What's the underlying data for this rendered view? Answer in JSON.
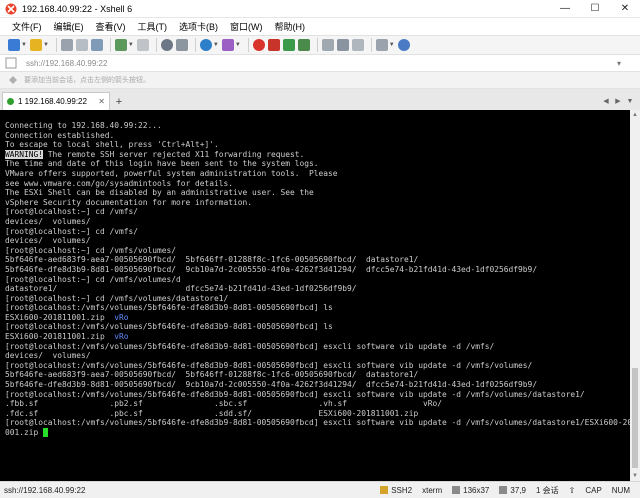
{
  "window": {
    "title": "192.168.40.99:22 - Xshell 6",
    "minimize": "—",
    "maximize": "☐",
    "close": "✕"
  },
  "menu": [
    "文件(F)",
    "编辑(E)",
    "查看(V)",
    "工具(T)",
    "选项卡(B)",
    "窗口(W)",
    "帮助(H)"
  ],
  "address": {
    "value": "ssh://192.168.40.99:22"
  },
  "hint": {
    "text": "要添加当前会话，点击左侧的箭头按钮。"
  },
  "tabs": [
    {
      "label": "1 192.168.40.99:22",
      "close": "✕"
    }
  ],
  "tab_add": "+",
  "terminal": {
    "intro": [
      "Connecting to 192.168.40.99:22...",
      "Connection established.",
      "To escape to local shell, press 'Ctrl+Alt+]'.",
      ""
    ],
    "warning_tag": "WARNING!",
    "warning_rest": " The remote SSH server rejected X11 forwarding request.",
    "body": [
      "The time and date of this login have been sent to the system logs.",
      "",
      "VMware offers supported, powerful system administration tools.  Please",
      "see www.vmware.com/go/sysadmintools for details.",
      "",
      "The ESXi Shell can be disabled by an administrative user. See the",
      "vSphere Security documentation for more information.",
      "[root@localhost:~] cd /vmfs/",
      "devices/  volumes/",
      "[root@localhost:~] cd /vmfs/",
      "devices/  volumes/",
      "[root@localhost:~] cd /vmfs/volumes/",
      "5bf646fe-aed683f9-aea7-00505690fbcd/  5bf646ff-01288f8c-1fc6-00505690fbcd/  datastore1/",
      "5bf646fe-dfe8d3b9-8d81-00505690fbcd/  9cb10a7d-2c005550-4f0a-4262f3d41294/  dfcc5e74-b21fd41d-43ed-1df0256df9b9/",
      "[root@localhost:~] cd /vmfs/volumes/d",
      "datastore1/                           dfcc5e74-b21fd41d-43ed-1df0256df9b9/",
      "[root@localhost:~] cd /vmfs/volumes/datastore1/",
      "[root@localhost:/vmfs/volumes/5bf646fe-dfe8d3b9-8d81-00505690fbcd] ls"
    ],
    "ls1_file": "ESXi600-201811001.zip  ",
    "ls1_dir": "vRo",
    "after_ls1": "[root@localhost:/vmfs/volumes/5bf646fe-dfe8d3b9-8d81-00505690fbcd] ls",
    "ls2_file": "ESXi600-201811001.zip  ",
    "ls2_dir": "vRo",
    "tail": [
      "[root@localhost:/vmfs/volumes/5bf646fe-dfe8d3b9-8d81-00505690fbcd] esxcli software vib update -d /vmfs/",
      "devices/  volumes/",
      "[root@localhost:/vmfs/volumes/5bf646fe-dfe8d3b9-8d81-00505690fbcd] esxcli software vib update -d /vmfs/volumes/",
      "5bf646fe-aed683f9-aea7-00505690fbcd/  5bf646ff-01288f8c-1fc6-00505690fbcd/  datastore1/",
      "5bf646fe-dfe8d3b9-8d81-00505690fbcd/  9cb10a7d-2c005550-4f0a-4262f3d41294/  dfcc5e74-b21fd41d-43ed-1df0256df9b9/",
      "[root@localhost:/vmfs/volumes/5bf646fe-dfe8d3b9-8d81-00505690fbcd] esxcli software vib update -d /vmfs/volumes/datastore1/",
      ".fbb.sf               .pb2.sf               .sbc.sf               .vh.sf                vRo/",
      ".fdc.sf               .pbc.sf               .sdd.sf/              ESXi600-201811001.zip",
      "[root@localhost:/vmfs/volumes/5bf646fe-dfe8d3b9-8d81-00505690fbcd] esxcli software vib update -d /vmfs/volumes/datastore1/ESXi600-201811"
    ],
    "last_line": "001.zip "
  },
  "status": {
    "connection": "ssh://192.168.40.99:22",
    "protocol": "SSH2",
    "terminal": "xterm",
    "size": "136x37",
    "cursor_pos": "37,9",
    "sessions": "1 会话",
    "caps": "CAP",
    "num": "NUM"
  },
  "colors": {
    "terminal_bg": "#000000",
    "terminal_fg": "#cccccc",
    "directory_blue": "#5c8cff",
    "cursor_green": "#2adf2a",
    "tab_connected": "#2e9e2e"
  }
}
